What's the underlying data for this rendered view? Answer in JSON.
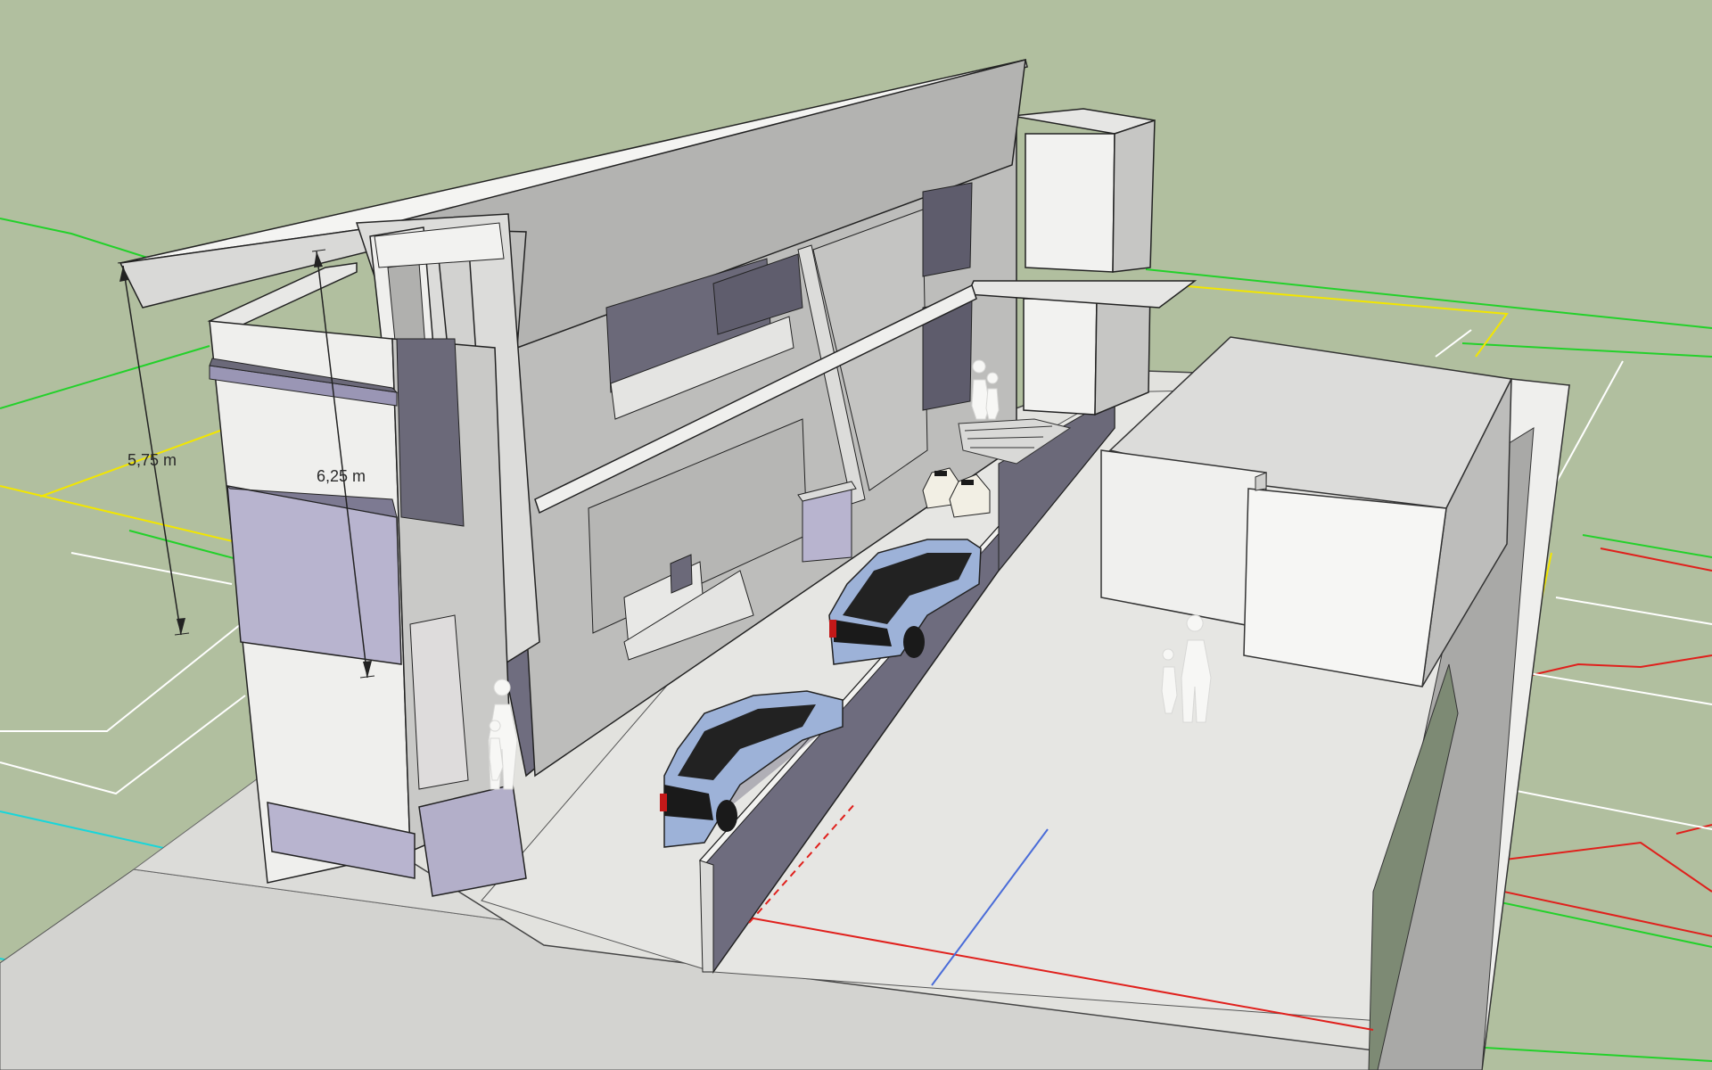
{
  "scene": {
    "background_color": "#b1bf9f",
    "dimensions": [
      {
        "label": "5,75 m"
      },
      {
        "label": "6,25 m"
      }
    ],
    "colors": {
      "wall_light": "#e4e4e2",
      "wall_mid": "#c8c8c6",
      "wall_dark": "#a9a9a7",
      "glass_purple": "#b8b4cf",
      "shadow_purple": "#6e6c7e",
      "ground": "#e2e2de",
      "road": "#d3d3d0",
      "car": "#9db2d8",
      "axis_red": "#e0201c",
      "axis_blue": "#4a6cd8",
      "guide_yellow": "#f2e600",
      "guide_green": "#23d12a",
      "guide_cyan": "#18d6da"
    }
  }
}
